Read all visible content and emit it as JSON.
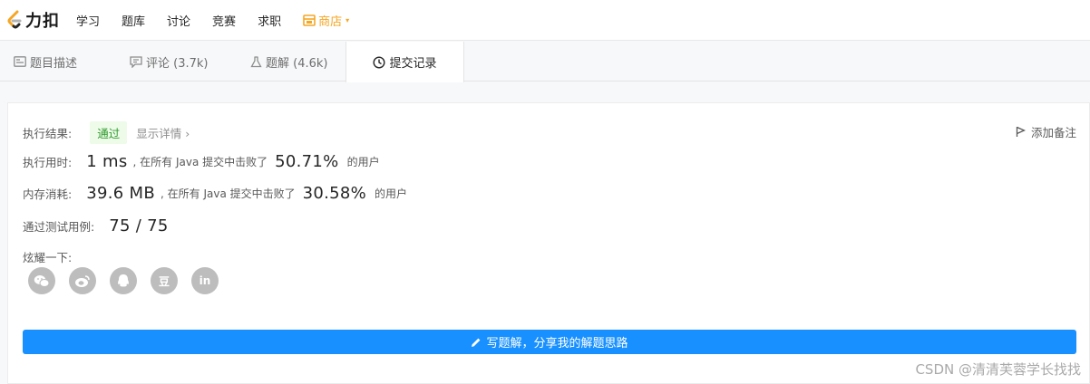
{
  "nav": {
    "logo_text": "力扣",
    "items": [
      "学习",
      "题库",
      "讨论",
      "竞赛",
      "求职"
    ],
    "store_label": "商店",
    "store_caret": "▾"
  },
  "tabs": [
    {
      "label": "题目描述",
      "icon": "description-icon"
    },
    {
      "label": "评论 (3.7k)",
      "icon": "comment-icon"
    },
    {
      "label": "题解 (4.6k)",
      "icon": "flask-icon"
    },
    {
      "label": "提交记录",
      "icon": "clock-icon",
      "active": true
    }
  ],
  "result": {
    "label": "执行结果:",
    "status": "通过",
    "details_link": "显示详情 ›",
    "add_note": "添加备注"
  },
  "runtime": {
    "label": "执行用时:",
    "value": "1 ms",
    "text1": ", 在所有 Java 提交中击败了",
    "percent": "50.71%",
    "text2": "的用户"
  },
  "memory": {
    "label": "内存消耗:",
    "value": "39.6 MB",
    "text1": ", 在所有 Java 提交中击败了",
    "percent": "30.58%",
    "text2": "的用户"
  },
  "tests": {
    "label": "通过测试用例:",
    "value": "75 / 75"
  },
  "share": {
    "label": "炫耀一下:",
    "icons": [
      "wechat-icon",
      "weibo-icon",
      "qq-icon",
      "douban-icon",
      "linkedin-icon"
    ],
    "douban_glyph": "豆",
    "linkedin_glyph": "in"
  },
  "cta_label": "写题解，分享我的解题思路",
  "watermark": "CSDN @清清芙蓉学长找找"
}
